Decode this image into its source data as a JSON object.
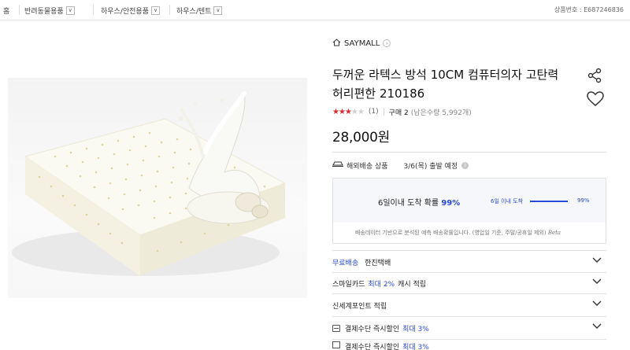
{
  "breadcrumb": [
    {
      "label": "홈"
    },
    {
      "label": "반려동물용품"
    },
    {
      "label": "하우스/안전용품"
    },
    {
      "label": "하우스/텐트"
    }
  ],
  "product_number": "상품번호 : E687246836",
  "brand": {
    "name": "SAYMALL"
  },
  "title": "두꺼운 라텍스 방석 10CM 컴퓨터의자 고탄력 허리편한 210186",
  "rating": {
    "stars": 3,
    "max": 5,
    "review_count": "(1)"
  },
  "purchase": {
    "label": "구매 2",
    "remaining": "(남은수량 5,992개)"
  },
  "price": "28,000원",
  "shipping": {
    "type": "해외배송 상품",
    "date": "3/6(목) 출발 예정"
  },
  "estimate": {
    "main_prefix": "6일이내 도착 확률",
    "main_percent": "99%",
    "bar_label": "6일 이내 도착",
    "bar_value": 0.99,
    "bar_percent": "99%",
    "note": "배송데이터 기반으로 분석된 예측 배송확률입니다. (영업일 기준, 주말/공휴일 제외)",
    "beta": "Beta"
  },
  "rows": [
    {
      "label": "무료배송",
      "extra": "한진택배"
    },
    {
      "label": "스마일카드",
      "highlight": "최대 2%",
      "suffix": "캐시 적립"
    },
    {
      "label": "신세계포인트 적립"
    },
    {
      "label": "결제수단 즉시할인",
      "highlight": "최대 3%"
    }
  ],
  "partial_row": {
    "label": "결제수단 즉시할인",
    "highlight": "최대 3%"
  },
  "colors": {
    "accent": "#2a49d6",
    "star": "#e0282f"
  }
}
